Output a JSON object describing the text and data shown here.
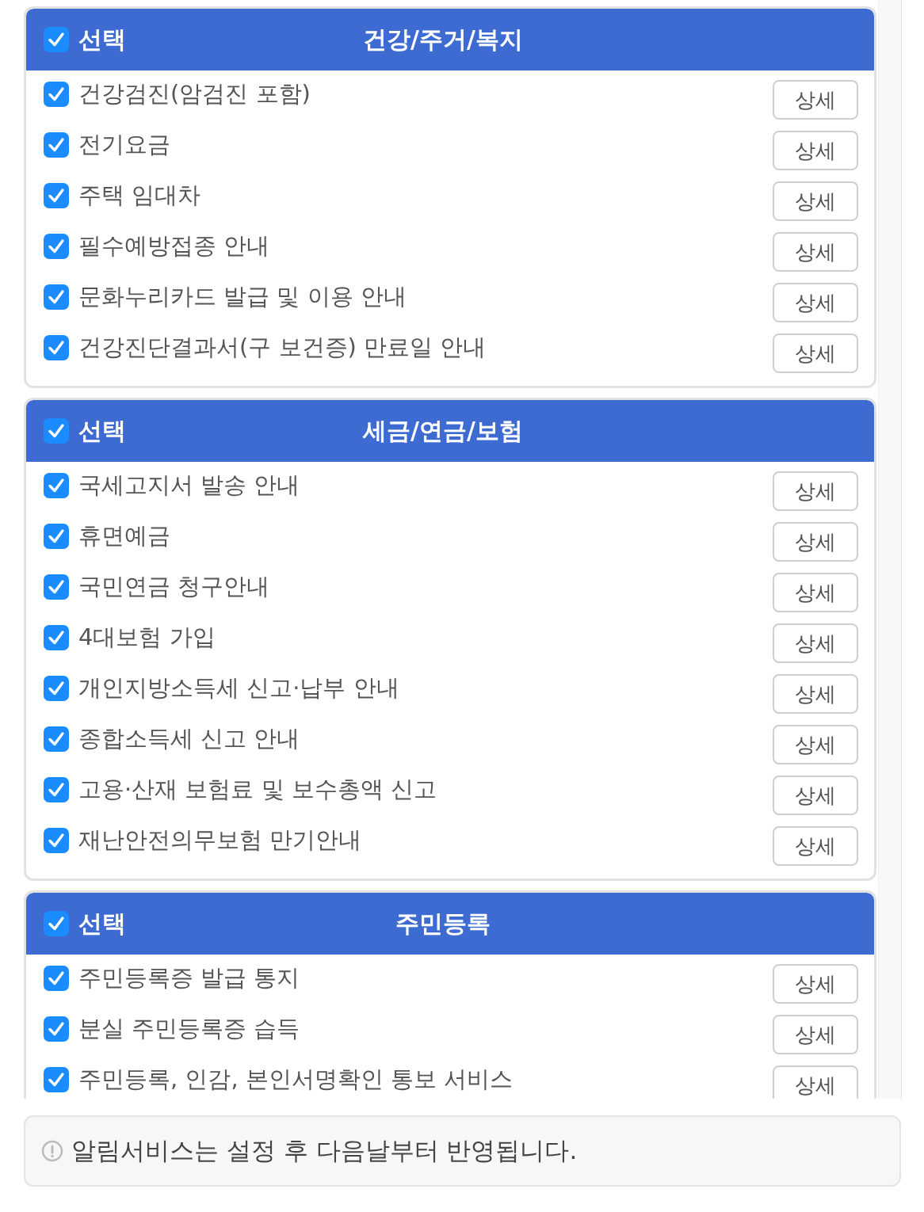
{
  "sections": [
    {
      "select_label": "선택",
      "checked": true,
      "title": "건강/주거/복지",
      "items": [
        {
          "label": "건강검진(암검진 포함)",
          "checked": true,
          "button": "상세"
        },
        {
          "label": "전기요금",
          "checked": true,
          "button": "상세"
        },
        {
          "label": "주택 임대차",
          "checked": true,
          "button": "상세"
        },
        {
          "label": "필수예방접종 안내",
          "checked": true,
          "button": "상세"
        },
        {
          "label": "문화누리카드 발급 및 이용 안내",
          "checked": true,
          "button": "상세"
        },
        {
          "label": "건강진단결과서(구 보건증) 만료일 안내",
          "checked": true,
          "button": "상세"
        }
      ]
    },
    {
      "select_label": "선택",
      "checked": true,
      "title": "세금/연금/보험",
      "items": [
        {
          "label": "국세고지서 발송 안내",
          "checked": true,
          "button": "상세"
        },
        {
          "label": "휴면예금",
          "checked": true,
          "button": "상세"
        },
        {
          "label": "국민연금 청구안내",
          "checked": true,
          "button": "상세"
        },
        {
          "label": "4대보험 가입",
          "checked": true,
          "button": "상세"
        },
        {
          "label": "개인지방소득세 신고·납부 안내",
          "checked": true,
          "button": "상세"
        },
        {
          "label": "종합소득세 신고 안내",
          "checked": true,
          "button": "상세"
        },
        {
          "label": "고용·산재 보험료 및 보수총액 신고",
          "checked": true,
          "button": "상세"
        },
        {
          "label": "재난안전의무보험 만기안내",
          "checked": true,
          "button": "상세"
        }
      ]
    },
    {
      "select_label": "선택",
      "checked": true,
      "title": "주민등록",
      "items": [
        {
          "label": "주민등록증 발급 통지",
          "checked": true,
          "button": "상세"
        },
        {
          "label": "분실 주민등록증 습득",
          "checked": true,
          "button": "상세"
        },
        {
          "label": "주민등록, 인감, 본인서명확인 통보 서비스",
          "checked": true,
          "button": "상세"
        }
      ]
    }
  ],
  "notice": {
    "text": "알림서비스는 설정 후 다음날부터 반영됩니다."
  }
}
